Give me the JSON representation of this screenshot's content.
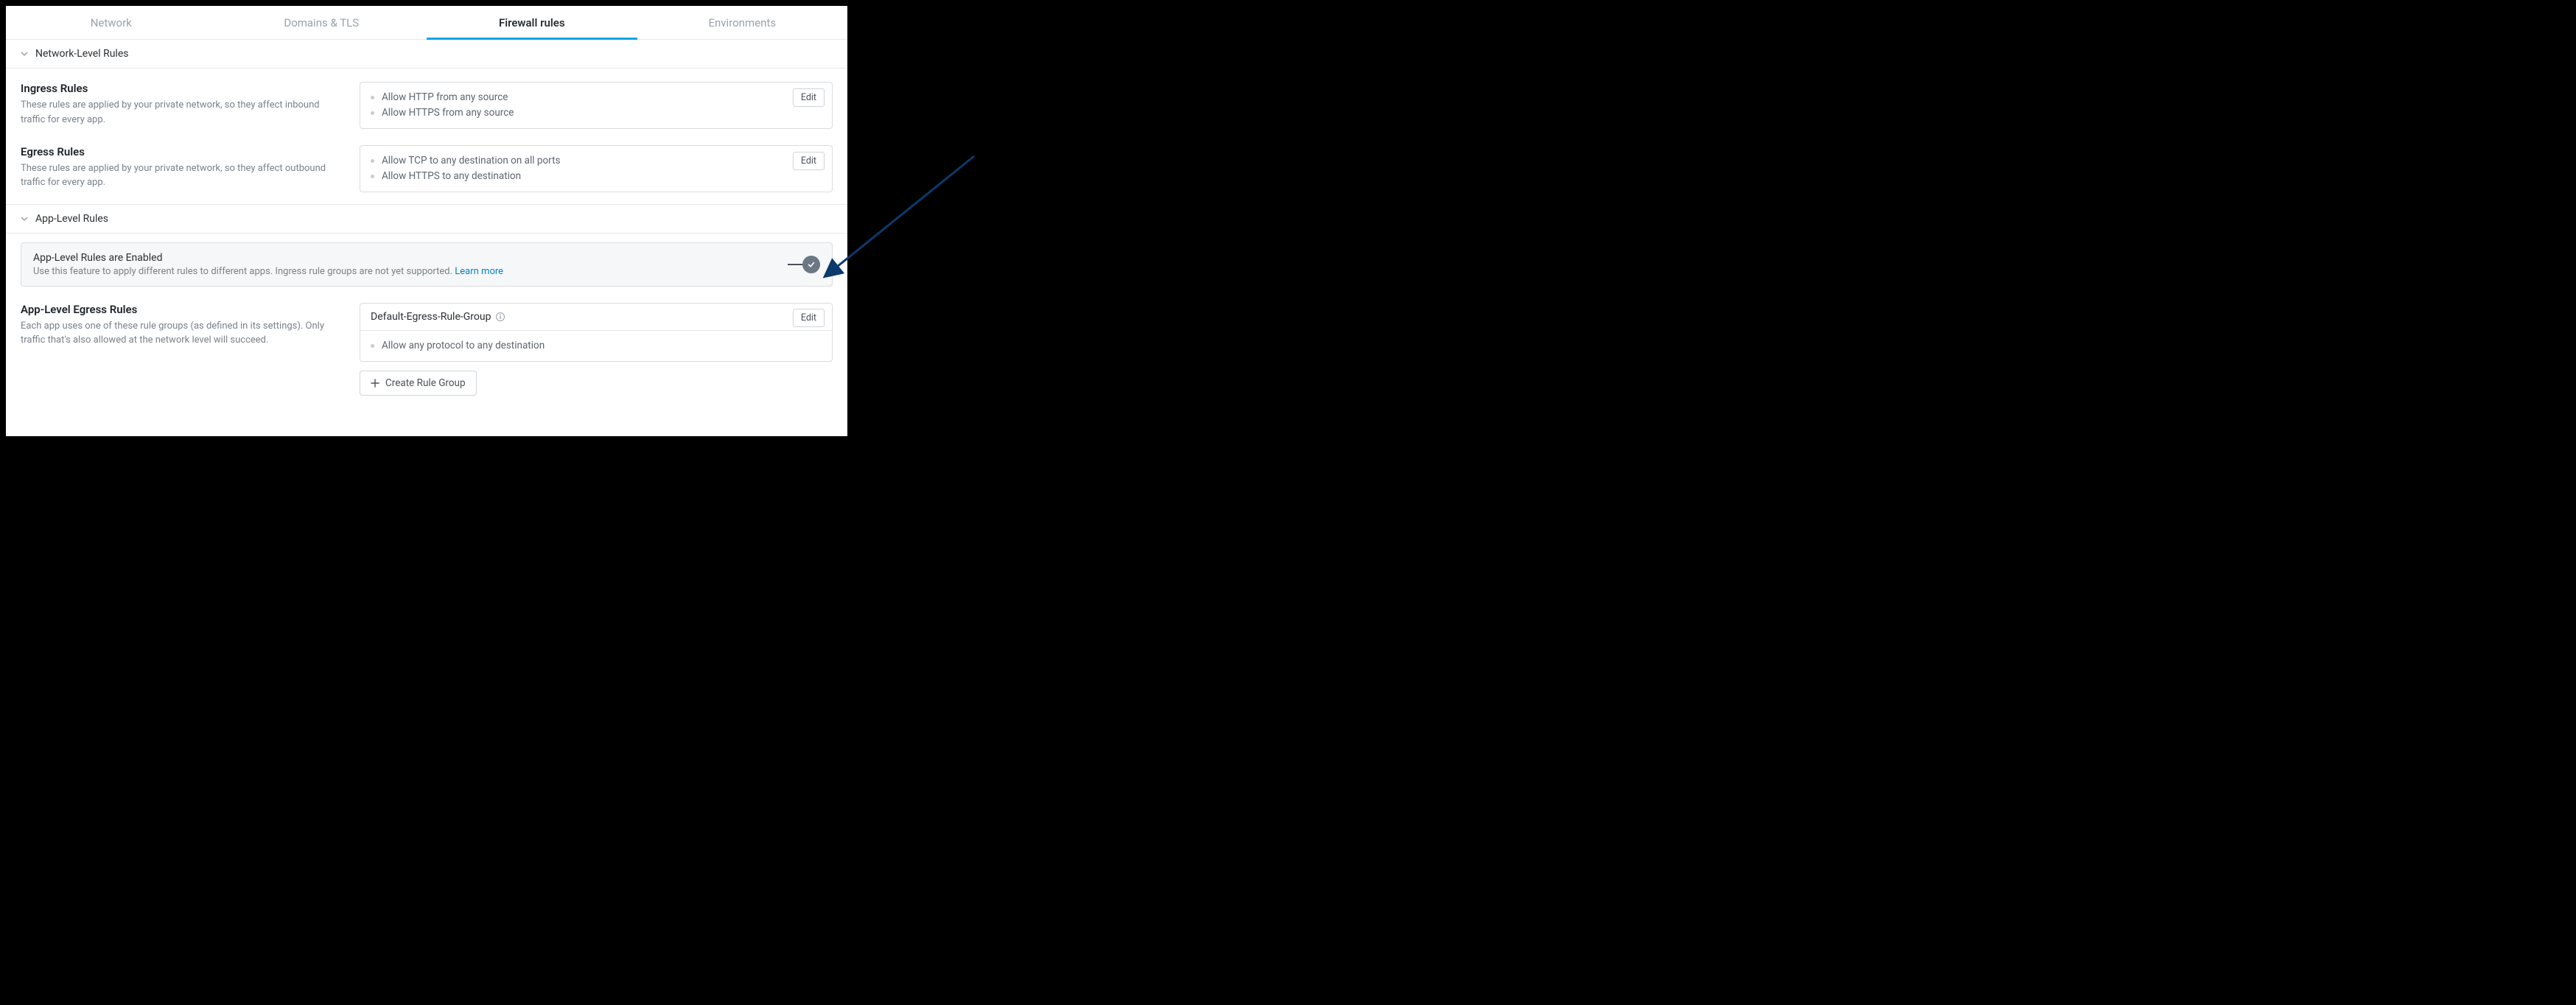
{
  "colors": {
    "accent": "#0ea5e9",
    "link": "#0284c7",
    "arrow": "#0b3a6b"
  },
  "tabs": [
    {
      "label": "Network",
      "active": false
    },
    {
      "label": "Domains & TLS",
      "active": false
    },
    {
      "label": "Firewall rules",
      "active": true
    },
    {
      "label": "Environments",
      "active": false
    }
  ],
  "network_section": {
    "header": "Network-Level Rules",
    "ingress": {
      "title": "Ingress Rules",
      "desc": "These rules are applied by your private network, so they affect inbound traffic for every app.",
      "rules": [
        "Allow HTTP from any source",
        "Allow HTTPS from any source"
      ],
      "edit_label": "Edit"
    },
    "egress": {
      "title": "Egress Rules",
      "desc": "These rules are applied by your private network, so they affect outbound traffic for every app.",
      "rules": [
        "Allow TCP to any destination on all ports",
        "Allow HTTPS to any destination"
      ],
      "edit_label": "Edit"
    }
  },
  "app_section": {
    "header": "App-Level Rules",
    "notice": {
      "title": "App-Level Rules are Enabled",
      "subtext": "Use this feature to apply different rules to different apps. Ingress rule groups are not yet supported. ",
      "link_label": "Learn more",
      "toggle_on": true
    },
    "egress": {
      "title": "App-Level Egress Rules",
      "desc": "Each app uses one of these rule groups (as defined in its settings). Only traffic that's also allowed at the network level will succeed.",
      "group_name": "Default-Egress-Rule-Group",
      "rules": [
        "Allow any protocol to any destination"
      ],
      "edit_label": "Edit",
      "create_label": "Create Rule Group"
    }
  }
}
